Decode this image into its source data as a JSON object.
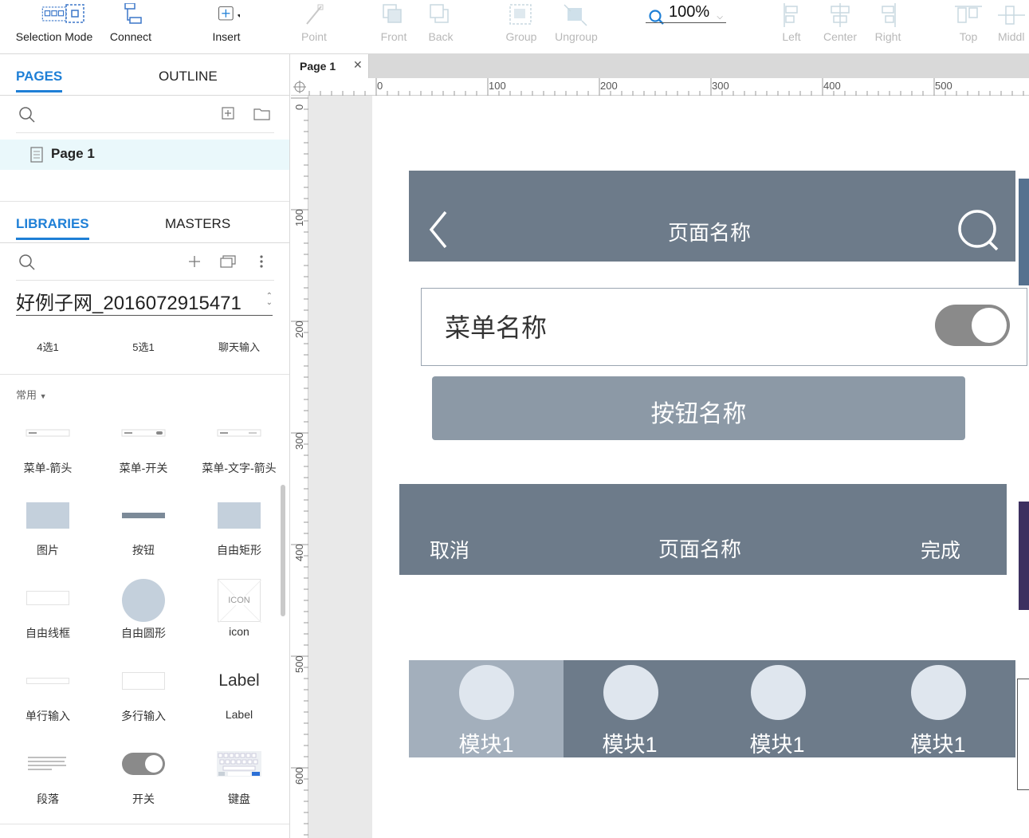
{
  "toolbar": {
    "selection_mode": "Selection Mode",
    "connect": "Connect",
    "insert": "Insert",
    "point": "Point",
    "front": "Front",
    "back": "Back",
    "group": "Group",
    "ungroup": "Ungroup",
    "zoom": "100%",
    "left": "Left",
    "center": "Center",
    "right": "Right",
    "top": "Top",
    "middle": "Middl"
  },
  "pages_panel": {
    "tab_pages": "PAGES",
    "tab_outline": "OUTLINE",
    "page_name": "Page 1"
  },
  "libraries_panel": {
    "tab_libraries": "LIBRARIES",
    "tab_masters": "MASTERS",
    "library_name": "好例子网_2016072915471",
    "quick_items": [
      "4选1",
      "5选1",
      "聊天输入"
    ],
    "section": "常用",
    "widgets": [
      {
        "label": "菜单-箭头",
        "icon": "menu-arrow-thumb"
      },
      {
        "label": "菜单-开关",
        "icon": "menu-switch-thumb"
      },
      {
        "label": "菜单-文字-箭头",
        "icon": "menu-text-arrow-thumb"
      },
      {
        "label": "图片",
        "icon": "image-thumb"
      },
      {
        "label": "按钮",
        "icon": "button-thumb"
      },
      {
        "label": "自由矩形",
        "icon": "rectangle-thumb"
      },
      {
        "label": "自由线框",
        "icon": "frame-thumb"
      },
      {
        "label": "自由圆形",
        "icon": "circle-thumb"
      },
      {
        "label": "icon",
        "icon": "icon-thumb",
        "thumb_text": "ICON"
      },
      {
        "label": "单行输入",
        "icon": "single-input-thumb"
      },
      {
        "label": "多行输入",
        "icon": "multi-input-thumb"
      },
      {
        "label": "Label",
        "icon": "label-thumb",
        "thumb_text": "Label"
      },
      {
        "label": "段落",
        "icon": "paragraph-thumb"
      },
      {
        "label": "开关",
        "icon": "switch-thumb"
      },
      {
        "label": "键盘",
        "icon": "keyboard-thumb"
      }
    ]
  },
  "editor": {
    "tab": "Page 1",
    "ruler_h": [
      "0",
      "100",
      "200",
      "300",
      "400",
      "500"
    ],
    "ruler_v": [
      "0",
      "100",
      "200",
      "300",
      "400",
      "500",
      "600"
    ]
  },
  "canvas": {
    "nav_title": "页面名称",
    "menu_title": "菜单名称",
    "toggle_on": true,
    "button_label": "按钮名称",
    "header2_cancel": "取消",
    "header2_title": "页面名称",
    "header2_done": "完成",
    "modules": [
      "模块1",
      "模块1",
      "模块1",
      "模块1"
    ]
  },
  "colors": {
    "accent": "#1e7fd6",
    "bar": "#6d7b8a",
    "bar_light": "#a3afbc",
    "button": "#8c99a6",
    "page_selected": "#eaf8fb"
  }
}
